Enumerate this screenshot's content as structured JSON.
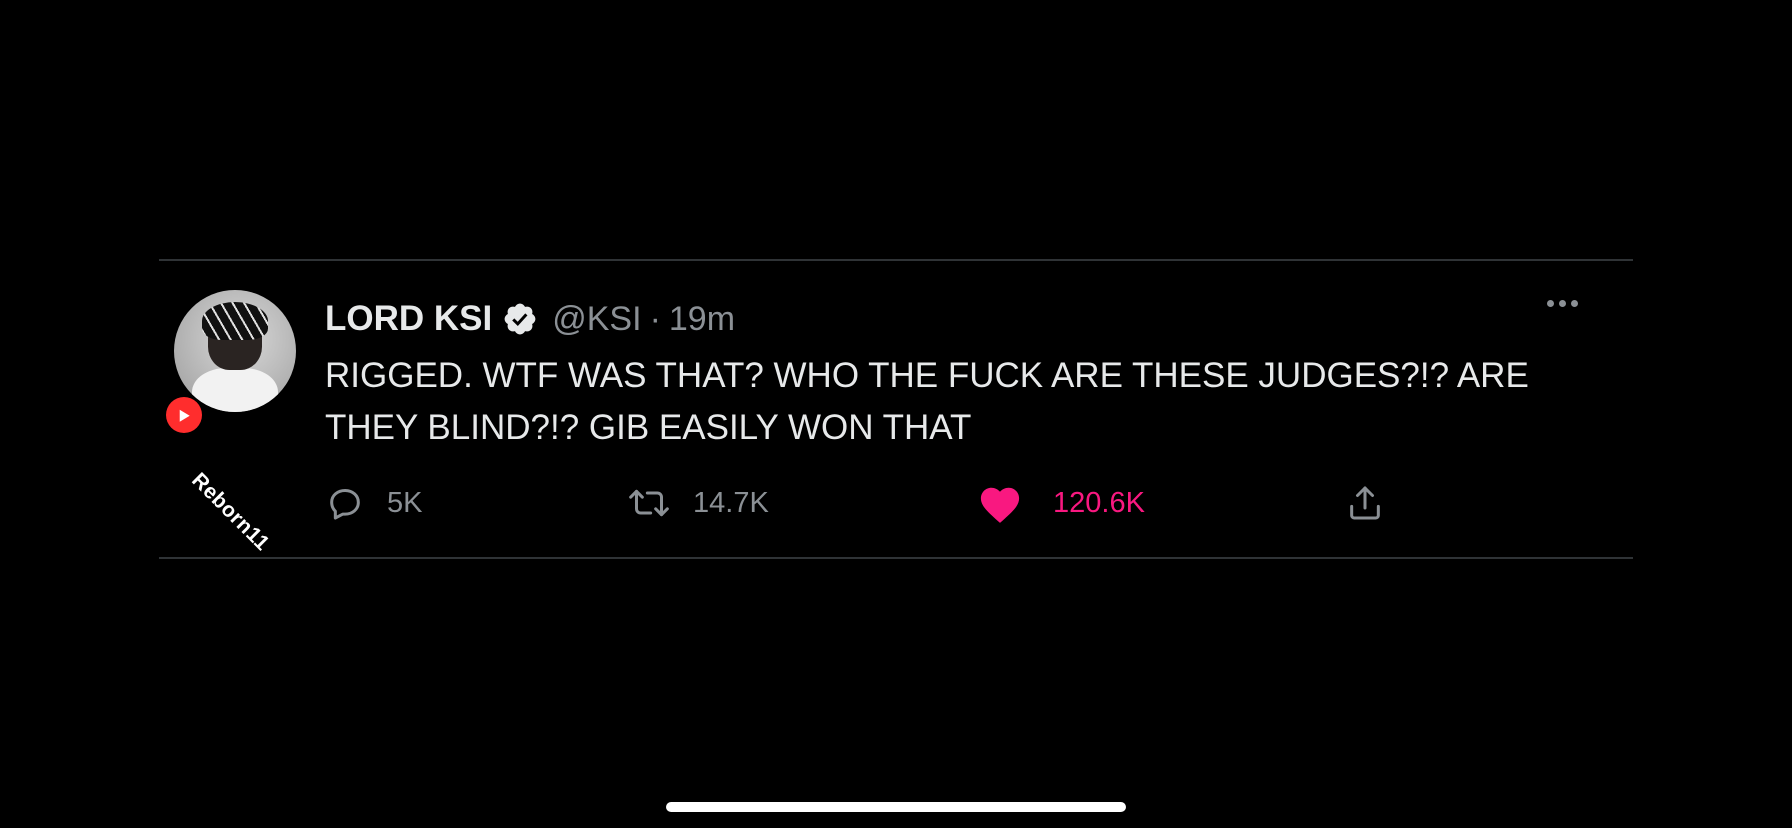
{
  "tweet": {
    "display_name": "LORD KSI",
    "handle": "@KSI",
    "separator": "·",
    "time": "19m",
    "text": "RIGGED. WTF WAS THAT? WHO THE FUCK ARE THESE JUDGES?!? ARE THEY BLIND?!? GIB EASILY WON THAT",
    "verified": true,
    "actions": {
      "reply": {
        "icon": "reply-icon",
        "count": "5K"
      },
      "retweet": {
        "icon": "retweet-icon",
        "count": "14.7K"
      },
      "like": {
        "icon": "heart-icon",
        "count": "120.6K",
        "liked": true,
        "color": "#f91880"
      },
      "share": {
        "icon": "share-icon"
      }
    }
  },
  "watermark": {
    "icon": "youtube-icon",
    "text": "Reborn11"
  },
  "colors": {
    "background": "#000000",
    "text": "#e7e9ea",
    "secondary": "#8b9095",
    "like": "#f91880",
    "youtube": "#ff2d2d"
  }
}
